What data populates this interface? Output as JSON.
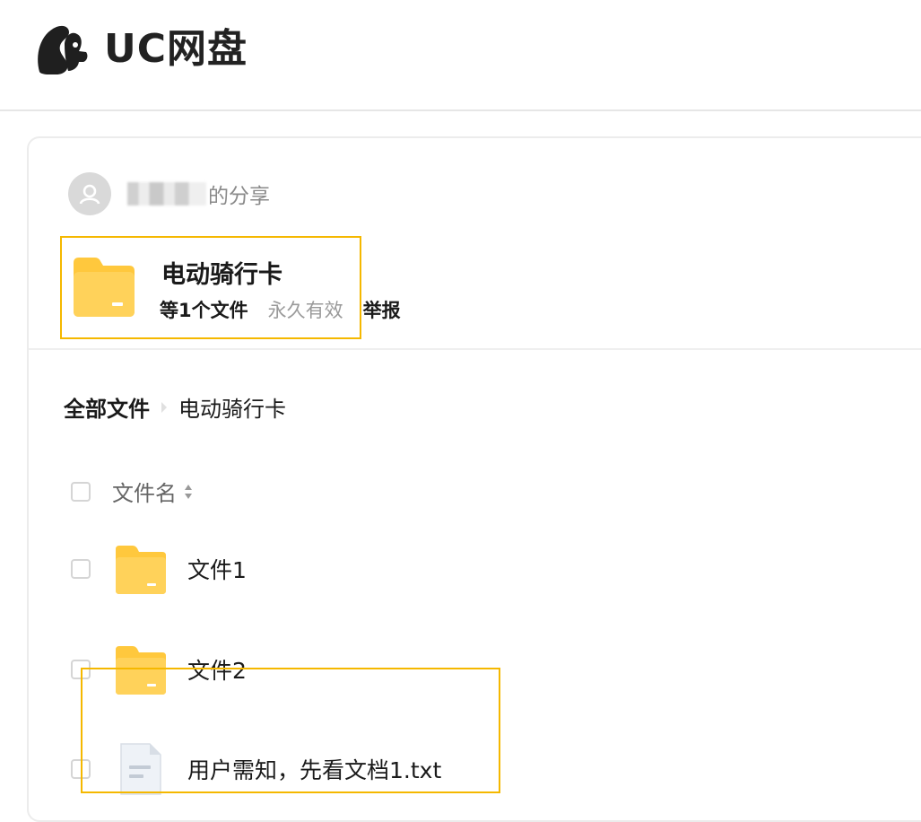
{
  "app": {
    "logo_text": "UC网盘",
    "logo_icon": "squirrel-logo-icon"
  },
  "share": {
    "sharer_suffix": "的分享",
    "avatar_icon": "user-avatar-icon",
    "folder_name": "电动骑行卡",
    "file_count": "等1个文件",
    "validity": "永久有效",
    "report_label": "举报"
  },
  "breadcrumb": {
    "root": "全部文件",
    "current": "电动骑行卡"
  },
  "list": {
    "header_label": "文件名",
    "rows": [
      {
        "name": "文件1",
        "type": "folder",
        "icon": "folder-icon"
      },
      {
        "name": "文件2",
        "type": "folder",
        "icon": "folder-icon"
      },
      {
        "name": "用户需知，先看文档1.txt",
        "type": "txt",
        "icon": "text-file-icon"
      }
    ]
  },
  "colors": {
    "folder": "#FFC83D",
    "highlight_border": "#F5B800",
    "muted_text": "#9A9A9A"
  }
}
